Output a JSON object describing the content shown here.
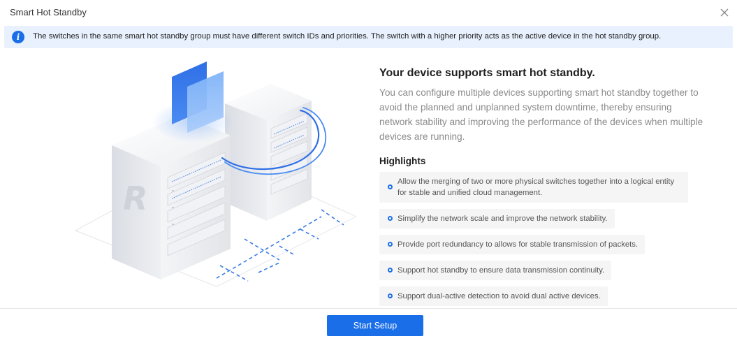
{
  "dialog": {
    "title": "Smart Hot Standby",
    "close_icon": "close-icon"
  },
  "notice": {
    "icon": "info-icon",
    "icon_glyph": "i",
    "text": "The switches in the same smart hot standby group must have different switch IDs and priorities. The switch with a higher priority acts as the active device in the hot standby group."
  },
  "illustration": {
    "logo_text": "R",
    "colors": {
      "accent": "#1a6ee8",
      "accent_light": "#6ea6f5"
    }
  },
  "info": {
    "title": "Your device supports smart hot standby.",
    "description": "You can configure multiple devices supporting smart hot standby together to avoid the planned and unplanned system downtime, thereby ensuring network stability and improving the performance of the devices when multiple devices are running.",
    "highlights_title": "Highlights",
    "highlights": [
      "Allow the merging of two or more physical switches together into a logical entity for stable and unified cloud management.",
      "Simplify the network scale and improve the network stability.",
      "Provide port redundancy to allows for stable transmission of packets.",
      "Support hot standby to ensure data transmission continuity.",
      "Support dual-active detection to avoid dual active devices."
    ]
  },
  "footer": {
    "start_button": "Start Setup"
  },
  "colors": {
    "primary": "#1a6ee8",
    "notice_bg": "#e8f1fd",
    "highlight_bg": "#f5f5f5"
  }
}
